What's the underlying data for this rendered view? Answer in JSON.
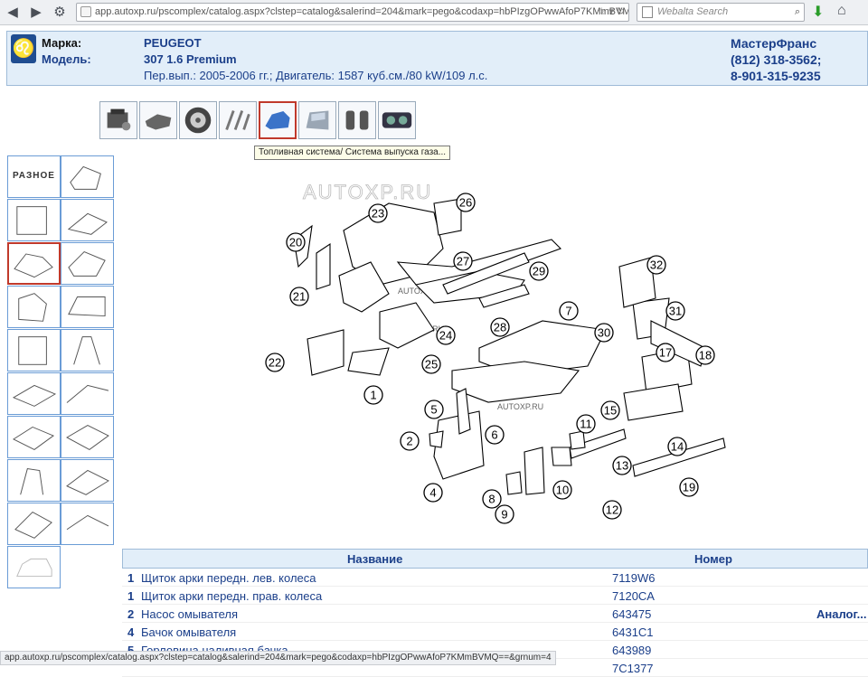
{
  "browser": {
    "url": "app.autoxp.ru/pscomplex/catalog.aspx?clstep=catalog&salerind=204&mark=pego&codaxp=hbPIzgOPwwAfoP7KMmBVMQ==&grnu",
    "search_placeholder": "Webalta Search"
  },
  "header": {
    "make_label": "Марка:",
    "make_value": "PEUGEOT",
    "model_label": "Модель:",
    "model_value": "307 1.6 Premium",
    "model_details": "Пер.вып.: 2005-2006 гг.; Двигатель: 1587 куб.см./80 kW/109 л.с.",
    "dealer_name": "МастерФранс",
    "dealer_phone1": "(812) 318-3562;",
    "dealer_phone2": "8-901-315-9235"
  },
  "categories": [
    "engine",
    "gearbox",
    "wheel",
    "suspension",
    "body-panel",
    "door",
    "seats",
    "dashboard"
  ],
  "selected_category": 4,
  "tooltip": "Топливная система/ Система выпуска газа...",
  "thumbnails": {
    "first_label": "РАЗНОЕ",
    "selected_index": 2
  },
  "diagram": {
    "watermark": "AUTOXP.RU",
    "callouts": [
      "1",
      "2",
      "4",
      "5",
      "6",
      "7",
      "8",
      "9",
      "10",
      "11",
      "12",
      "13",
      "14",
      "15",
      "17",
      "18",
      "19",
      "20",
      "21",
      "22",
      "23",
      "24",
      "25",
      "26",
      "27",
      "28",
      "29",
      "30",
      "31",
      "32"
    ]
  },
  "table": {
    "col_name": "Название",
    "col_number": "Номер",
    "rows": [
      {
        "no": "1",
        "name": "Щиток арки передн. лев. колеса",
        "number": "7119W6",
        "analog": ""
      },
      {
        "no": "1",
        "name": "Щиток арки передн. прав. колеса",
        "number": "7120CA",
        "analog": ""
      },
      {
        "no": "2",
        "name": "Насос омывателя",
        "number": "643475",
        "analog": "Аналог..."
      },
      {
        "no": "4",
        "name": "Бачок омывателя",
        "number": "6431C1",
        "analog": ""
      },
      {
        "no": "5",
        "name": "Горловина наливная бачка",
        "number": "643989",
        "analog": ""
      },
      {
        "no": "",
        "name": "",
        "number": "7C1377",
        "analog": ""
      }
    ]
  },
  "statusbar": "app.autoxp.ru/pscomplex/catalog.aspx?clstep=catalog&salerind=204&mark=pego&codaxp=hbPIzgOPwwAfoP7KMmBVMQ==&grnum=4"
}
